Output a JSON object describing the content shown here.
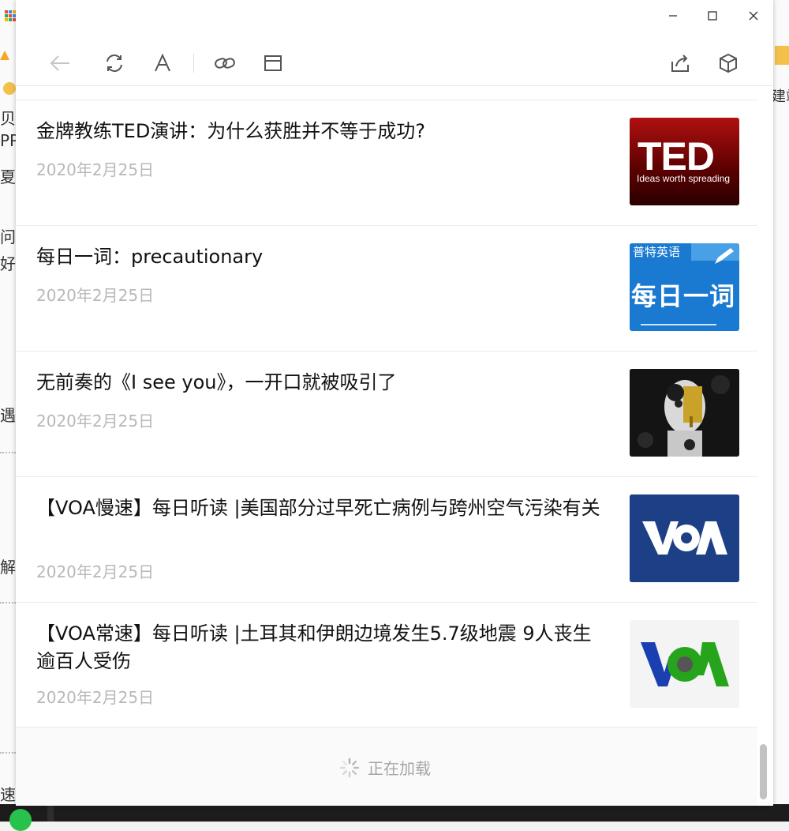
{
  "window": {
    "controls": {
      "minimize": "minimize",
      "maximize": "maximize",
      "close": "close"
    }
  },
  "toolbar": {
    "icons": [
      "back-arrow-icon",
      "refresh-icon",
      "font-icon",
      "link-icon",
      "window-icon",
      "share-icon",
      "cube-icon"
    ]
  },
  "articles": [
    {
      "title": "金牌教练TED演讲：为什么获胜并不等于成功?",
      "date": "2020年2月25日",
      "thumbnail": "TED"
    },
    {
      "title": "每日一词：precautionary",
      "date": "2020年2月25日",
      "thumbnail": "每日一词"
    },
    {
      "title": "无前奏的《I see you》，一开口就被吸引了",
      "date": "2020年2月25日",
      "thumbnail": "artwork"
    },
    {
      "title": "【VOA慢速】每日听读 |美国部分过早死亡病例与跨州空气污染有关",
      "date": "2020年2月25日",
      "thumbnail": "VOA"
    },
    {
      "title": "【VOA常速】每日听读 |土耳其和伊朗边境发生5.7级地震 9人丧生逾百人受伤",
      "date": "2020年2月25日",
      "thumbnail": "VOA"
    }
  ],
  "thumbnails": {
    "ted_big": "TED",
    "ted_small": "Ideas worth spreading",
    "word_badge": "普特英语",
    "word_title": "每日一词",
    "voa": "VOA"
  },
  "footer": {
    "loading_text": "正在加载"
  },
  "background": {
    "left_fragments": [
      "贝",
      "PPI",
      "夏",
      "问题",
      "好如",
      "遇到",
      "解",
      "速"
    ],
    "right_fragments": [
      "建站"
    ]
  }
}
